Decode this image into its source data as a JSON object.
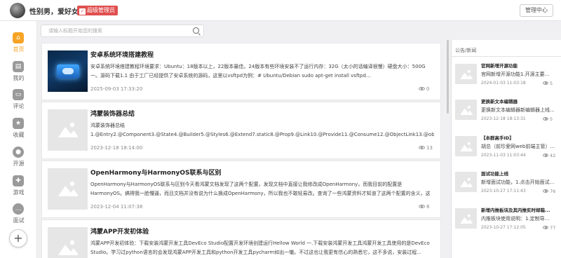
{
  "header": {
    "username": "性别男，爱好女",
    "badge": "超级管理员",
    "admin_button": "管理中心"
  },
  "sidebar": {
    "items": [
      {
        "label": "首页",
        "icon": "home-icon",
        "active": true
      },
      {
        "label": "我的",
        "icon": "user-icon",
        "active": false
      },
      {
        "label": "评论",
        "icon": "comment-icon",
        "active": false
      },
      {
        "label": "收藏",
        "icon": "star-icon",
        "active": false
      },
      {
        "label": "开源",
        "icon": "open-source-icon",
        "active": false
      },
      {
        "label": "游戏",
        "icon": "game-icon",
        "active": false
      },
      {
        "label": "面试",
        "icon": "interview-icon",
        "active": false
      }
    ],
    "add_button": "+"
  },
  "search": {
    "placeholder": "请输入标题开始您的搜索"
  },
  "articles": [
    {
      "title": "安卓系统环境搭建教程",
      "desc": "安卓系统环境搭建教程环境要求：Ubuntu：18版本以上，22版本最佳。24版本有些环境安装不了运行内存：32G（太小的话编译很慢）硬盘大小：500G一。源码下载1.1 由于工厂已经提供了安卓系统的源码，这里以vsftpd为例：# Ubuntu/Debian sudo apt-get install vsftpd...",
      "date": "2025-09-03 17:33:20",
      "views": "0",
      "thumb": "photo"
    },
    {
      "title": "鸿蒙装饰器总结",
      "desc": "鸿蒙装饰器总结\n1.@Entry2.@Component3.@State4.@Builder5.@Styles6.@Extend7.static8.@Prop9.@Link10.@Provide11.@Consume12.@ObjectLink13.@observed@Entry@Component...",
      "date": "2023-12-18 18:14:00",
      "views": "13",
      "thumb": "placeholder"
    },
    {
      "title": "OpenHarmony与HarmonyOS联系与区别",
      "desc": "OpenHarmony与HarmonyOS联系与区别今天看鸿蒙文档发现了这两个配置，发现文档中直接让我修改成OpenHarmony，而我目前的配置是HarmonyOS。搞得我一脸懵逼，而且文档并没有说为什么换成OpenHarmony，所以我也不敢轻易改。查询了一些鸿蒙资料才知道了这两个配置的含义，这里做个简单的分享...",
      "date": "2023-12-04 11:07:38",
      "views": "8",
      "thumb": "placeholder"
    },
    {
      "title": "鸿蒙APP开发初体验",
      "desc": "鸿蒙APP开发初体验：下载安装鸿蒙开发工具DevEco Studio配置开发环境创建运行Hellow World 一.下载安装鸿蒙开发工具鸿蒙开发工具使用的是DevEco Studio。学习过python语言的会发现鸿蒙APP开发工具和python开发工具pycharm如出一辙。不过这也让我更有信心的熟悉它，这不多说，安装过程...",
      "date": "",
      "views": "",
      "thumb": "placeholder"
    }
  ],
  "news": {
    "title": "公告/新闻",
    "items": [
      {
        "title": "官网新增开源功能",
        "desc": "官网新增开源功能1.开源主要...",
        "date": "2024-01-03 11:03:18",
        "views": "5"
      },
      {
        "title": "更换新文本编辑器",
        "desc": "更换新文本编辑器新编辑器上线...",
        "date": "2023-12-18 18:13:31",
        "views": "5"
      },
      {
        "title": "【本群高手ID】",
        "desc": "胡总（前珍爱网web前端主管）...",
        "date": "2023-11-03 11:03:44",
        "views": "42"
      },
      {
        "title": "面试功能上线",
        "desc": "新增面试功能，1.点击开始面试...",
        "date": "2023-10-27 17:11:43",
        "views": "76"
      },
      {
        "title": "新增内推板块及其内推实时邮箱...",
        "desc": "内推板块使用说明：1.定制导...",
        "date": "2023-10-27 17:12:05",
        "views": "77"
      }
    ]
  },
  "colors": {
    "accent": "#f7a425",
    "badge": "#e05050"
  }
}
